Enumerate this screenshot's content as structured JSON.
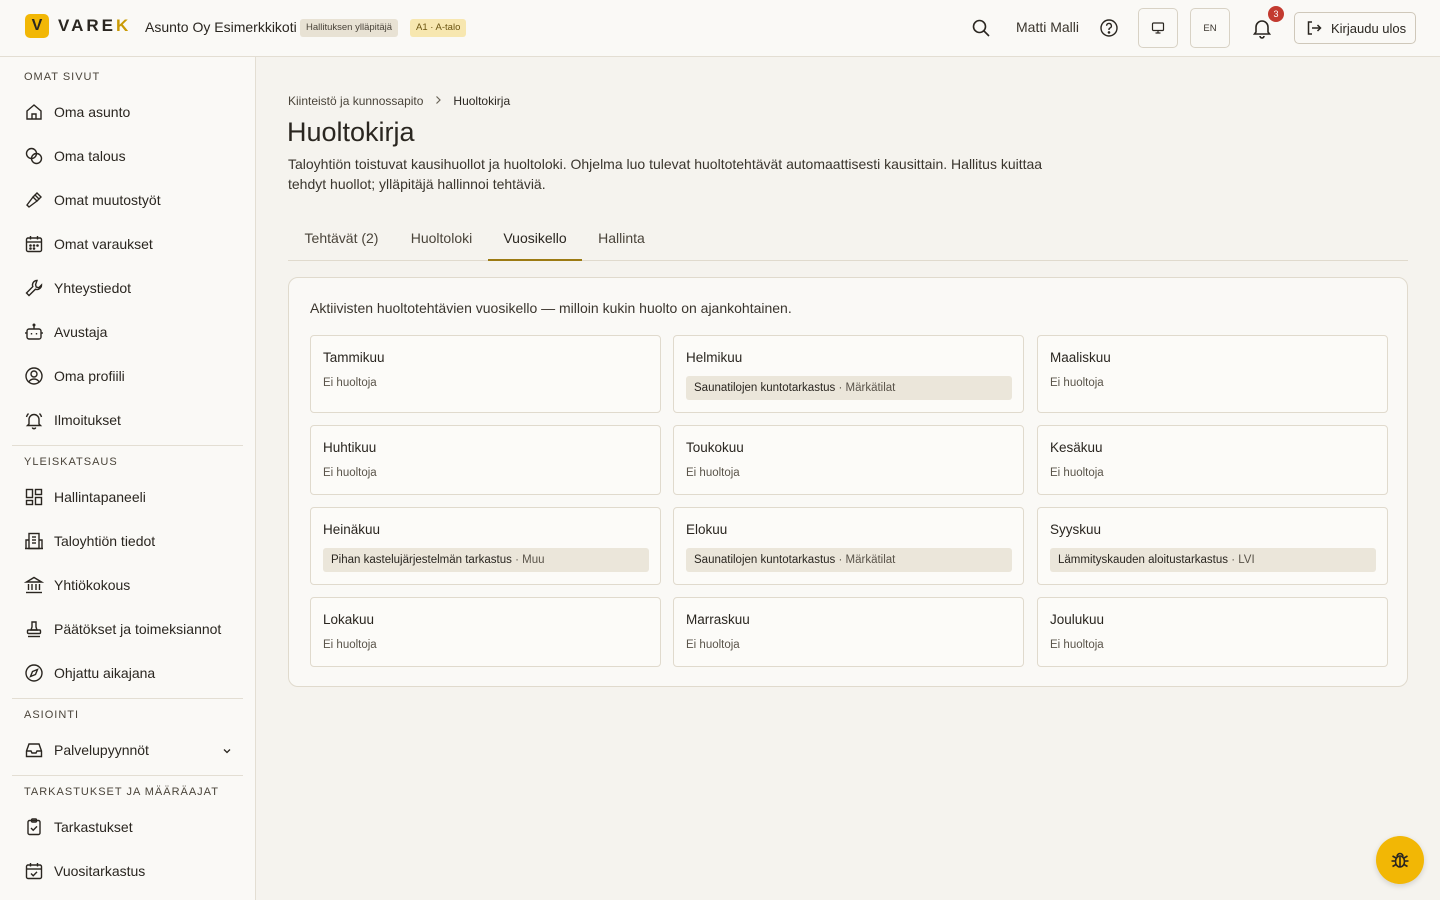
{
  "header": {
    "logo_mark": "V",
    "logo_text_main": "VARE",
    "logo_text_accent": "K",
    "org_name": "Asunto Oy Esimerkkikoti",
    "role_badge": "Hallituksen ylläpitäjä",
    "unit_badge": "A1 · A-talo",
    "user_name": "Matti Malli",
    "lang_button": "EN",
    "notification_count": "3",
    "logout_label": "Kirjaudu ulos"
  },
  "sidebar": {
    "sections": [
      {
        "title": "OMAT SIVUT",
        "items": [
          {
            "label": "Oma asunto",
            "icon": "home-icon"
          },
          {
            "label": "Oma talous",
            "icon": "coins-icon"
          },
          {
            "label": "Omat muutostyöt",
            "icon": "hammer-icon"
          },
          {
            "label": "Omat varaukset",
            "icon": "calendar-icon"
          },
          {
            "label": "Yhteystiedot",
            "icon": "wrench-icon"
          },
          {
            "label": "Avustaja",
            "icon": "bot-icon"
          },
          {
            "label": "Oma profiili",
            "icon": "user-circle-icon"
          },
          {
            "label": "Ilmoitukset",
            "icon": "bell-ring-icon"
          }
        ]
      },
      {
        "title": "YLEISKATSAUS",
        "items": [
          {
            "label": "Hallintapaneeli",
            "icon": "dashboard-icon"
          },
          {
            "label": "Taloyhtiön tiedot",
            "icon": "building-icon"
          },
          {
            "label": "Yhtiökokous",
            "icon": "landmark-icon"
          },
          {
            "label": "Päätökset ja toimeksiannot",
            "icon": "stamp-icon"
          },
          {
            "label": "Ohjattu aikajana",
            "icon": "compass-icon"
          }
        ]
      },
      {
        "title": "ASIOINTI",
        "items": [
          {
            "label": "Palvelupyynnöt",
            "icon": "inbox-icon"
          }
        ]
      },
      {
        "title": "TARKASTUKSET JA MÄÄRÄAJAT",
        "items": [
          {
            "label": "Tarkastukset",
            "icon": "clipboard-check-icon"
          },
          {
            "label": "Vuositarkastus",
            "icon": "calendar-check-icon"
          }
        ]
      }
    ]
  },
  "breadcrumb": {
    "parent": "Kiinteistö ja kunnossapito",
    "current": "Huoltokirja"
  },
  "page": {
    "title": "Huoltokirja",
    "description": "Taloyhtiön toistuvat kausihuollot ja huoltoloki. Ohjelma luo tulevat huoltotehtävät automaattisesti kausittain. Hallitus kuittaa tehdyt huollot; ylläpitäjä hallinnoi tehtäviä."
  },
  "tabs": [
    {
      "label": "Tehtävät  (2)",
      "active": false
    },
    {
      "label": "Huoltoloki",
      "active": false
    },
    {
      "label": "Vuosikello",
      "active": true
    },
    {
      "label": "Hallinta",
      "active": false
    }
  ],
  "calendar": {
    "intro": "Aktiivisten huoltotehtävien vuosikello — milloin kukin huolto on ajankohtainen.",
    "empty_label": "Ei huoltoja",
    "months": [
      {
        "name": "Tammikuu",
        "tasks": []
      },
      {
        "name": "Helmikuu",
        "tasks": [
          {
            "title": "Saunatilojen kuntotarkastus",
            "category": "Märkätilat"
          }
        ]
      },
      {
        "name": "Maaliskuu",
        "tasks": []
      },
      {
        "name": "Huhtikuu",
        "tasks": []
      },
      {
        "name": "Toukokuu",
        "tasks": []
      },
      {
        "name": "Kesäkuu",
        "tasks": []
      },
      {
        "name": "Heinäkuu",
        "tasks": [
          {
            "title": "Pihan kastelujärjestelmän tarkastus",
            "category": "Muu"
          }
        ]
      },
      {
        "name": "Elokuu",
        "tasks": [
          {
            "title": "Saunatilojen kuntotarkastus",
            "category": "Märkätilat"
          }
        ]
      },
      {
        "name": "Syyskuu",
        "tasks": [
          {
            "title": "Lämmityskauden aloitustarkastus",
            "category": "LVI"
          }
        ]
      },
      {
        "name": "Lokakuu",
        "tasks": []
      },
      {
        "name": "Marraskuu",
        "tasks": []
      },
      {
        "name": "Joulukuu",
        "tasks": []
      }
    ]
  },
  "colors": {
    "accent": "#f2b705",
    "tab_active_underline": "#9c7a12",
    "notification": "#c33a2f"
  }
}
